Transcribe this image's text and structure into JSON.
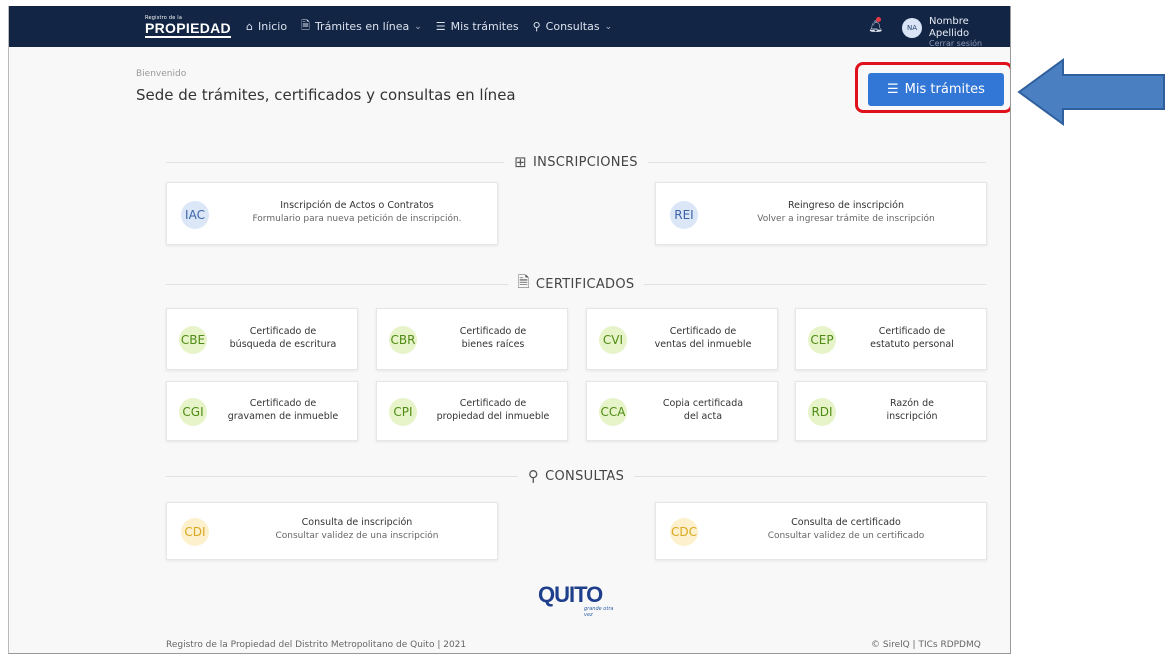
{
  "navbar": {
    "logo_small": "Registro de la",
    "logo_big": "PROPIEDAD",
    "items": [
      {
        "icon": "home-icon",
        "label": "Inicio",
        "dropdown": false
      },
      {
        "icon": "document-icon",
        "label": "Trámites en línea",
        "dropdown": true
      },
      {
        "icon": "list-icon",
        "label": "Mis trámites",
        "dropdown": false
      },
      {
        "icon": "search-icon",
        "label": "Consultas",
        "dropdown": true
      }
    ],
    "avatar_initials": "NA",
    "user_name": "Nombre Apellido",
    "logout": "Cerrar sesión"
  },
  "header": {
    "welcome": "Bienvenido",
    "title": "Sede de trámites, certificados y consultas en línea",
    "mis_tramites_button": "Mis trámites"
  },
  "sections": {
    "inscripciones": "INSCRIPCIONES",
    "certificados": "CERTIFICADOS",
    "consultas": "CONSULTAS"
  },
  "inscripciones": [
    {
      "code": "IAC",
      "title": "Inscripción de Actos o Contratos",
      "subtitle": "Formulario para nueva petición de inscripción."
    },
    {
      "code": "REI",
      "title": "Reingreso de inscripción",
      "subtitle": "Volver a ingresar trámite de inscripción"
    }
  ],
  "certificados": [
    {
      "code": "CBE",
      "line1": "Certificado de",
      "line2": "búsqueda de escritura"
    },
    {
      "code": "CBR",
      "line1": "Certificado de",
      "line2": "bienes raíces"
    },
    {
      "code": "CVI",
      "line1": "Certificado de",
      "line2": "ventas del inmueble"
    },
    {
      "code": "CEP",
      "line1": "Certificado de",
      "line2": "estatuto personal"
    },
    {
      "code": "CGI",
      "line1": "Certificado de",
      "line2": "gravamen de inmueble"
    },
    {
      "code": "CPI",
      "line1": "Certificado de",
      "line2": "propiedad del inmueble"
    },
    {
      "code": "CCA",
      "line1": "Copia certificada",
      "line2": "del acta"
    },
    {
      "code": "RDI",
      "line1": "Razón de",
      "line2": "inscripción"
    }
  ],
  "consultas": [
    {
      "code": "CDI",
      "title": "Consulta de inscripción",
      "subtitle": "Consultar validez de una inscripción"
    },
    {
      "code": "CDC",
      "title": "Consulta de certificado",
      "subtitle": "Consultar validez de un certificado"
    }
  ],
  "brand": {
    "quito": "QUITO",
    "tagline": "grande otra vez"
  },
  "footer": {
    "left": "Registro de la Propiedad del Distrito Metropolitano de Quito | 2021",
    "right": "© SirelQ | TICs RDPDMQ"
  },
  "colors": {
    "navbar": "#132544",
    "primary_button": "#3377d6",
    "highlight": "#e0101c",
    "arrow": "#4a7fc1"
  }
}
